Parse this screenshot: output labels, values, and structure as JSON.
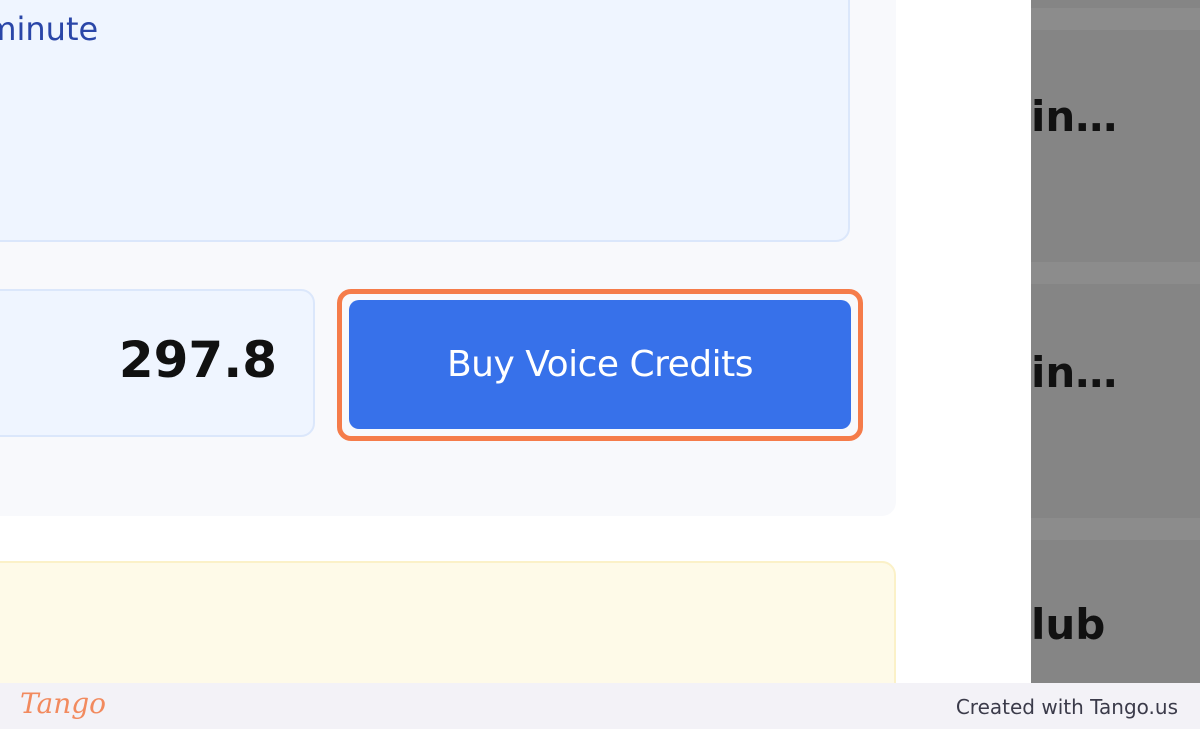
{
  "info_card": {
    "text": "r minute"
  },
  "balance": {
    "value": "297.8"
  },
  "buy_button": {
    "label": "Buy Voice Credits"
  },
  "right_panel": {
    "items": [
      "in…",
      "in…",
      "lub"
    ]
  },
  "footer": {
    "logo": "Tango",
    "credit": "Created with Tango.us"
  },
  "colors": {
    "accent": "#3771ea",
    "highlight": "#f57c4a",
    "info_text": "#2a46a8"
  }
}
